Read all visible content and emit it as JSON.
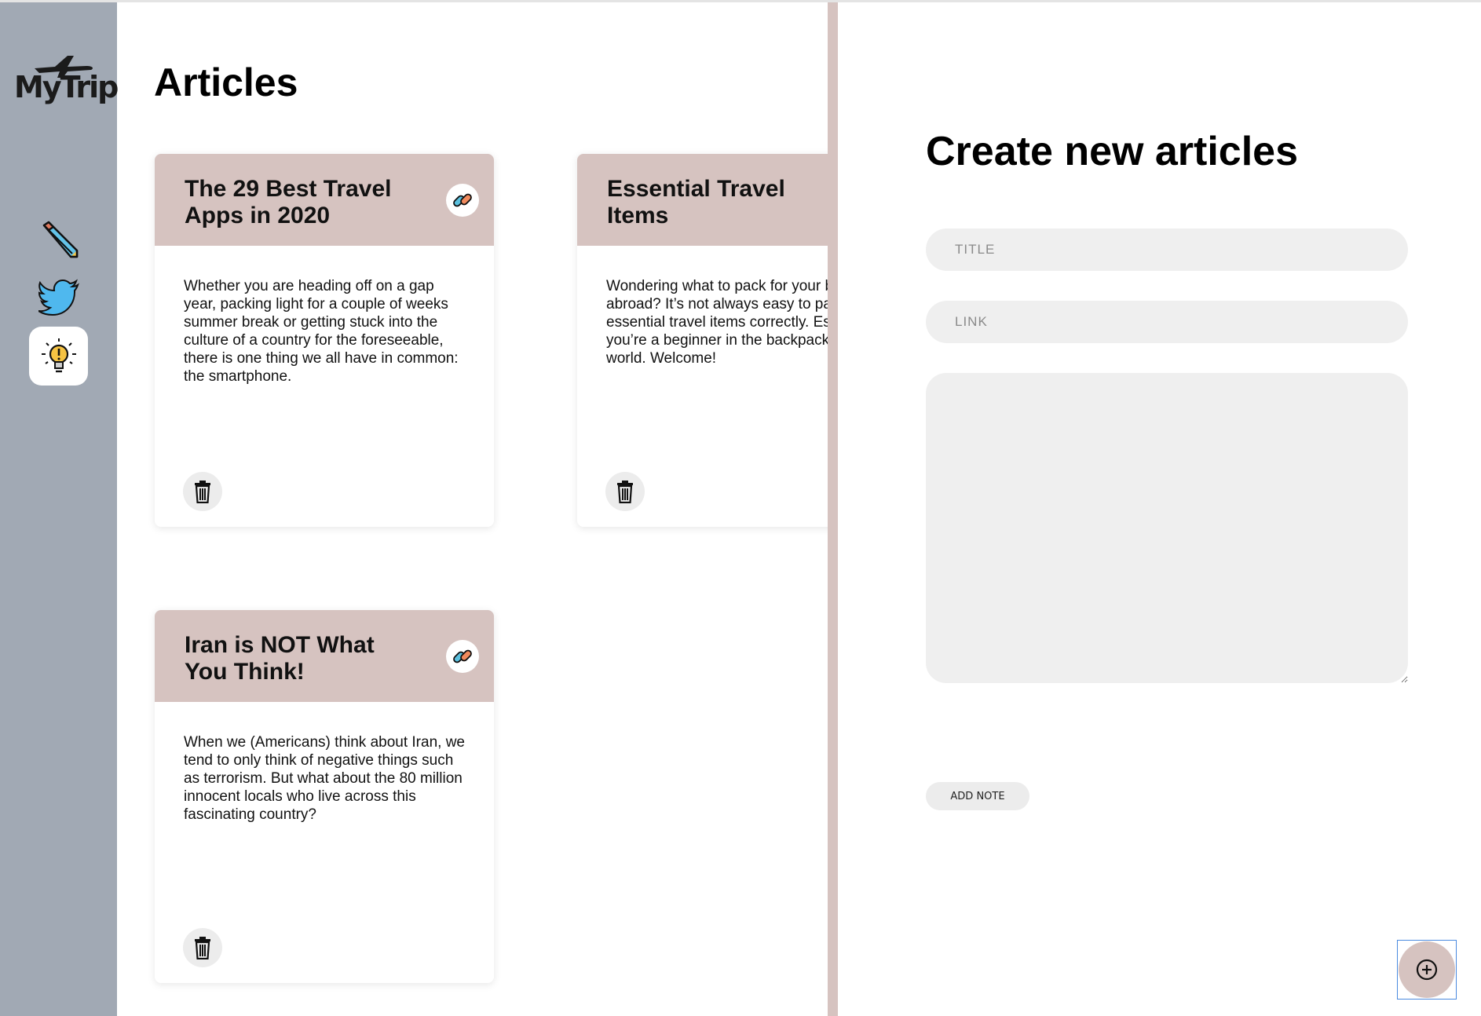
{
  "app": {
    "logo_text": "MyTrip"
  },
  "sidebar": {
    "items": [
      {
        "name": "notes",
        "icon": "pen-icon"
      },
      {
        "name": "twitter",
        "icon": "twitter-bird-icon"
      },
      {
        "name": "articles",
        "icon": "lightbulb-icon",
        "active": true
      }
    ]
  },
  "articles": {
    "title": "Articles",
    "cards": [
      {
        "title": "The 29 Best Travel Apps in 2020",
        "body": "Whether you are heading off on a gap year, packing light for a couple of weeks summer break or getting stuck into the culture of a country for the foreseeable, there is one thing we all have in common: the smartphone."
      },
      {
        "title": "Essential Travel Items",
        "body": "Wondering what to pack for your big trip abroad? It’s not always easy to pack the essential travel items correctly. Especially if you’re a beginner in the backpacking world. Welcome!"
      },
      {
        "title": "Iran is NOT What You Think!",
        "body": "When we (Americans) think about Iran, we tend to only think of negative things such as terrorism. But what about the 80 million innocent locals who live across this fascinating country?"
      }
    ]
  },
  "panel": {
    "title": "Create new articles",
    "title_placeholder": "TITLE",
    "link_placeholder": "LINK",
    "body_value": "",
    "add_button": "ADD NOTE",
    "fab_icon": "plus-circle-icon"
  },
  "colors": {
    "sidebar": "#a1a9b4",
    "accent": "#d6c3c0",
    "field": "#efefef"
  }
}
